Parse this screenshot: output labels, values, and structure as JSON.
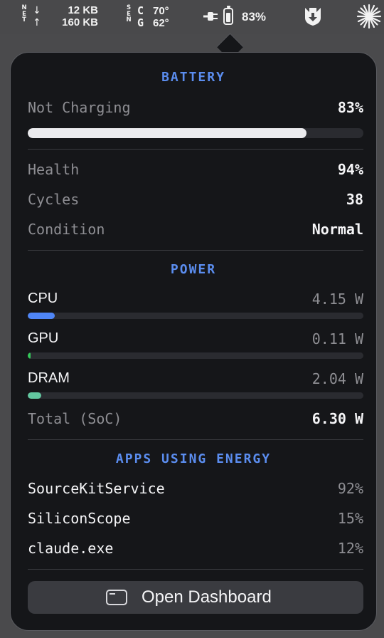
{
  "menubar": {
    "net_letters_top": "N",
    "net_letters_mid": "E",
    "net_letters_bot": "T",
    "down_arrow": "↓",
    "up_arrow": "↑",
    "net_down": "12 KB",
    "net_up": "160 KB",
    "sens_letters_1": "S",
    "sens_letters_2": "E",
    "sens_letters_3": "N",
    "sens_c": "C",
    "sens_g": "G",
    "cpu_temp": "70°",
    "gpu_temp": "62°",
    "battery_percent": "83%",
    "battery_level": 0.83,
    "icons": [
      "plug-icon",
      "battery-icon",
      "shield-download-icon",
      "sunburst-icon"
    ]
  },
  "battery": {
    "title": "BATTERY",
    "status": "Not Charging",
    "percent": "83%",
    "level": 0.83,
    "health_label": "Health",
    "health_value": "94%",
    "cycles_label": "Cycles",
    "cycles_value": "38",
    "condition_label": "Condition",
    "condition_value": "Normal"
  },
  "power": {
    "title": "POWER",
    "items": [
      {
        "name": "CPU",
        "watts": "4.15 W",
        "level": 0.08,
        "color": "#4f86f7"
      },
      {
        "name": "GPU",
        "watts": "0.11 W",
        "level": 0.006,
        "color": "#34c759"
      },
      {
        "name": "DRAM",
        "watts": "2.04 W",
        "level": 0.04,
        "color": "#63c7a0"
      }
    ],
    "total_label": "Total (SoC)",
    "total_value": "6.30 W"
  },
  "apps": {
    "title": "APPS USING ENERGY",
    "items": [
      {
        "name": "SourceKitService",
        "pct": "92%"
      },
      {
        "name": "SiliconScope",
        "pct": "15%"
      },
      {
        "name": "claude.exe",
        "pct": "12%"
      }
    ]
  },
  "dashboard_button": {
    "label": "Open Dashboard",
    "icon": "window-icon"
  }
}
